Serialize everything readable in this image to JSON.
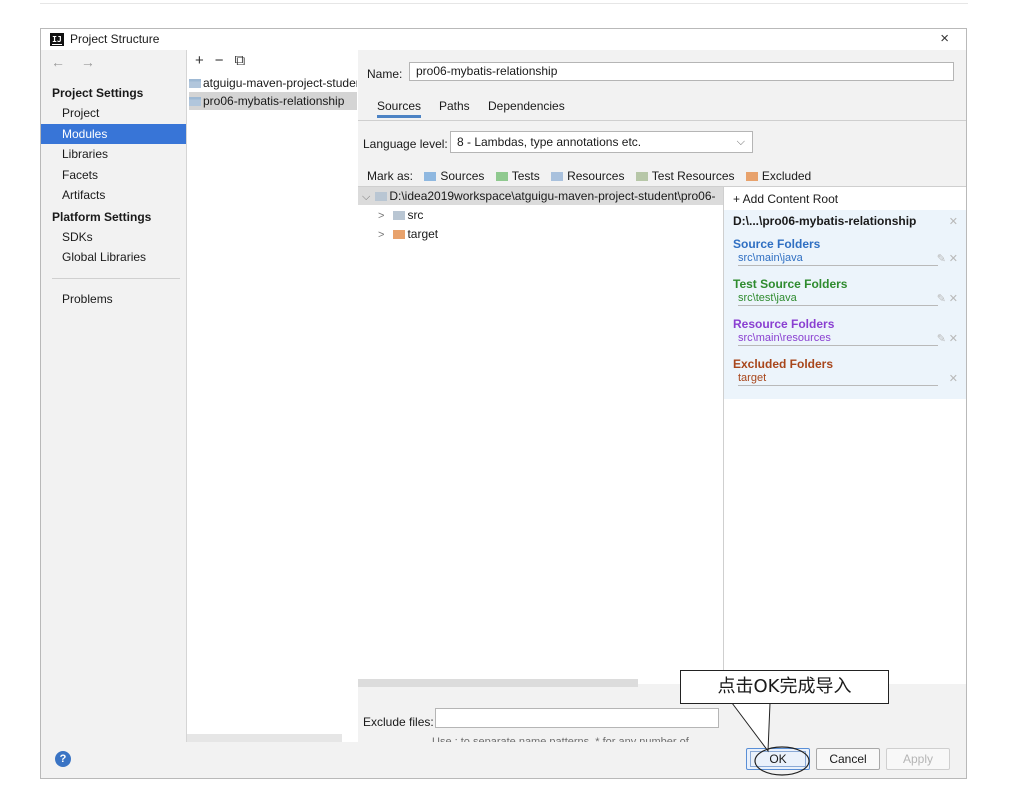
{
  "window": {
    "title": "Project Structure",
    "close": "×"
  },
  "left_nav": {
    "arrows": "← →",
    "project_settings_header": "Project Settings",
    "project_settings_items": [
      {
        "label": "Project"
      },
      {
        "label": "Modules"
      },
      {
        "label": "Libraries"
      },
      {
        "label": "Facets"
      },
      {
        "label": "Artifacts"
      }
    ],
    "platform_settings_header": "Platform Settings",
    "platform_settings_items": [
      {
        "label": "SDKs"
      },
      {
        "label": "Global Libraries"
      }
    ],
    "problems": "Problems",
    "selected": "Modules"
  },
  "modules_pane": {
    "tools": {
      "add": "+",
      "remove": "−",
      "copy": "⧉"
    },
    "modules": [
      {
        "label": "atguigu-maven-project-student"
      },
      {
        "label": "pro06-mybatis-relationship"
      }
    ]
  },
  "detail": {
    "name_label": "Name:",
    "name_value": "pro06-mybatis-relationship",
    "tabs": [
      {
        "label": "Sources"
      },
      {
        "label": "Paths"
      },
      {
        "label": "Dependencies"
      }
    ],
    "active_tab": "Sources",
    "language_level_label": "Language level:",
    "language_level_value": "8 - Lambdas, type annotations etc.",
    "mark_as": {
      "label": "Mark as:",
      "items": [
        {
          "label": "Sources",
          "color": "#8fb8e0"
        },
        {
          "label": "Tests",
          "color": "#8fc98f"
        },
        {
          "label": "Resources",
          "color": "#a9c1dd"
        },
        {
          "label": "Test Resources",
          "color": "#b7c7a8"
        },
        {
          "label": "Excluded",
          "color": "#e8a26c"
        }
      ]
    },
    "tree": {
      "root": "D:\\idea2019workspace\\atguigu-maven-project-student\\pro06-",
      "children": [
        {
          "label": "src"
        },
        {
          "label": "target"
        }
      ]
    },
    "content_roots": {
      "add_label": "+ Add Content Root",
      "root_path": "D:\\...\\pro06-mybatis-relationship",
      "groups": [
        {
          "title": "Source Folders",
          "path": "src\\main\\java",
          "color": "#2f6fc2"
        },
        {
          "title": "Test Source Folders",
          "path": "src\\test\\java",
          "color": "#2e8b2e"
        },
        {
          "title": "Resource Folders",
          "path": "src\\main\\resources",
          "color": "#8a3fd1"
        },
        {
          "title": "Excluded Folders",
          "path": "target",
          "color": "#a8461b"
        }
      ]
    },
    "exclude_files_label": "Exclude files:",
    "exclude_files_value": "",
    "exclude_hint": "Use ; to separate name patterns, * for any number of symbols, ? for one."
  },
  "buttons": {
    "ok": "OK",
    "cancel": "Cancel",
    "apply": "Apply",
    "help": "?"
  },
  "annotation": {
    "text": "点击OK完成导入"
  }
}
